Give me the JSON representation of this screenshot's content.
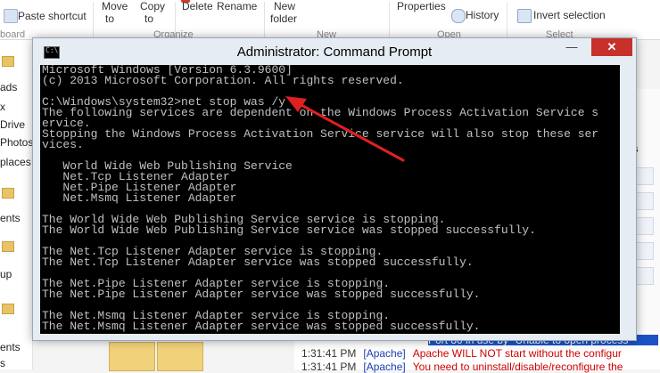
{
  "ribbon": {
    "paste_shortcut": "Paste shortcut",
    "clipboard_group": "board",
    "move_to": "Move",
    "move_to_sub": "to",
    "copy_to": "Copy",
    "copy_to_sub": "to",
    "organize_group": "Organize",
    "delete": "Delete",
    "rename": "Rename",
    "new_folder": "New",
    "new_folder_sub": "folder",
    "new_group": "New",
    "properties": "Properties",
    "history": "History",
    "open_group": "Open",
    "invert_selection": "Invert selection",
    "select_group": "Select"
  },
  "nav_pane": {
    "items": [
      "ads",
      "x",
      "Drive",
      "Photos",
      "places",
      "ents",
      "up",
      "ents",
      "s"
    ]
  },
  "right_pane": {
    "label": "s"
  },
  "log": {
    "rows": [
      {
        "time": "1:31:41 PM",
        "source": "[Apache]",
        "message": "Apache WILL NOT start without the configur"
      },
      {
        "time": "1:31:41 PM",
        "source": "[Apache]",
        "message": "You need to uninstall/disable/reconfigure the"
      }
    ],
    "highlight": "Port 80 in use by \"Unable to open process\""
  },
  "window": {
    "title": "Administrator: Command Prompt",
    "icon_text": "C:\\",
    "minimize": "—",
    "close": "✕"
  },
  "console": {
    "lines": [
      "Microsoft Windows [Version 6.3.9600]",
      "(c) 2013 Microsoft Corporation. All rights reserved.",
      "",
      "C:\\Windows\\system32>net stop was /y",
      "The following services are dependent on the Windows Process Activation Service s",
      "ervice.",
      "Stopping the Windows Process Activation Service service will also stop these ser",
      "vices.",
      "",
      "   World Wide Web Publishing Service",
      "   Net.Tcp Listener Adapter",
      "   Net.Pipe Listener Adapter",
      "   Net.Msmq Listener Adapter",
      "",
      "The World Wide Web Publishing Service service is stopping.",
      "The World Wide Web Publishing Service service was stopped successfully.",
      "",
      "The Net.Tcp Listener Adapter service is stopping.",
      "The Net.Tcp Listener Adapter service was stopped successfully.",
      "",
      "The Net.Pipe Listener Adapter service is stopping.",
      "The Net.Pipe Listener Adapter service was stopped successfully.",
      "",
      "The Net.Msmq Listener Adapter service is stopping.",
      "The Net.Msmq Listener Adapter service was stopped successfully."
    ]
  },
  "colors": {
    "console_bg": "#000000",
    "console_text": "#c0c0c0",
    "annotation_arrow": "#e02020",
    "close_button": "#c7302b",
    "log_source": "#1a3fb0",
    "log_message": "#d00000"
  }
}
